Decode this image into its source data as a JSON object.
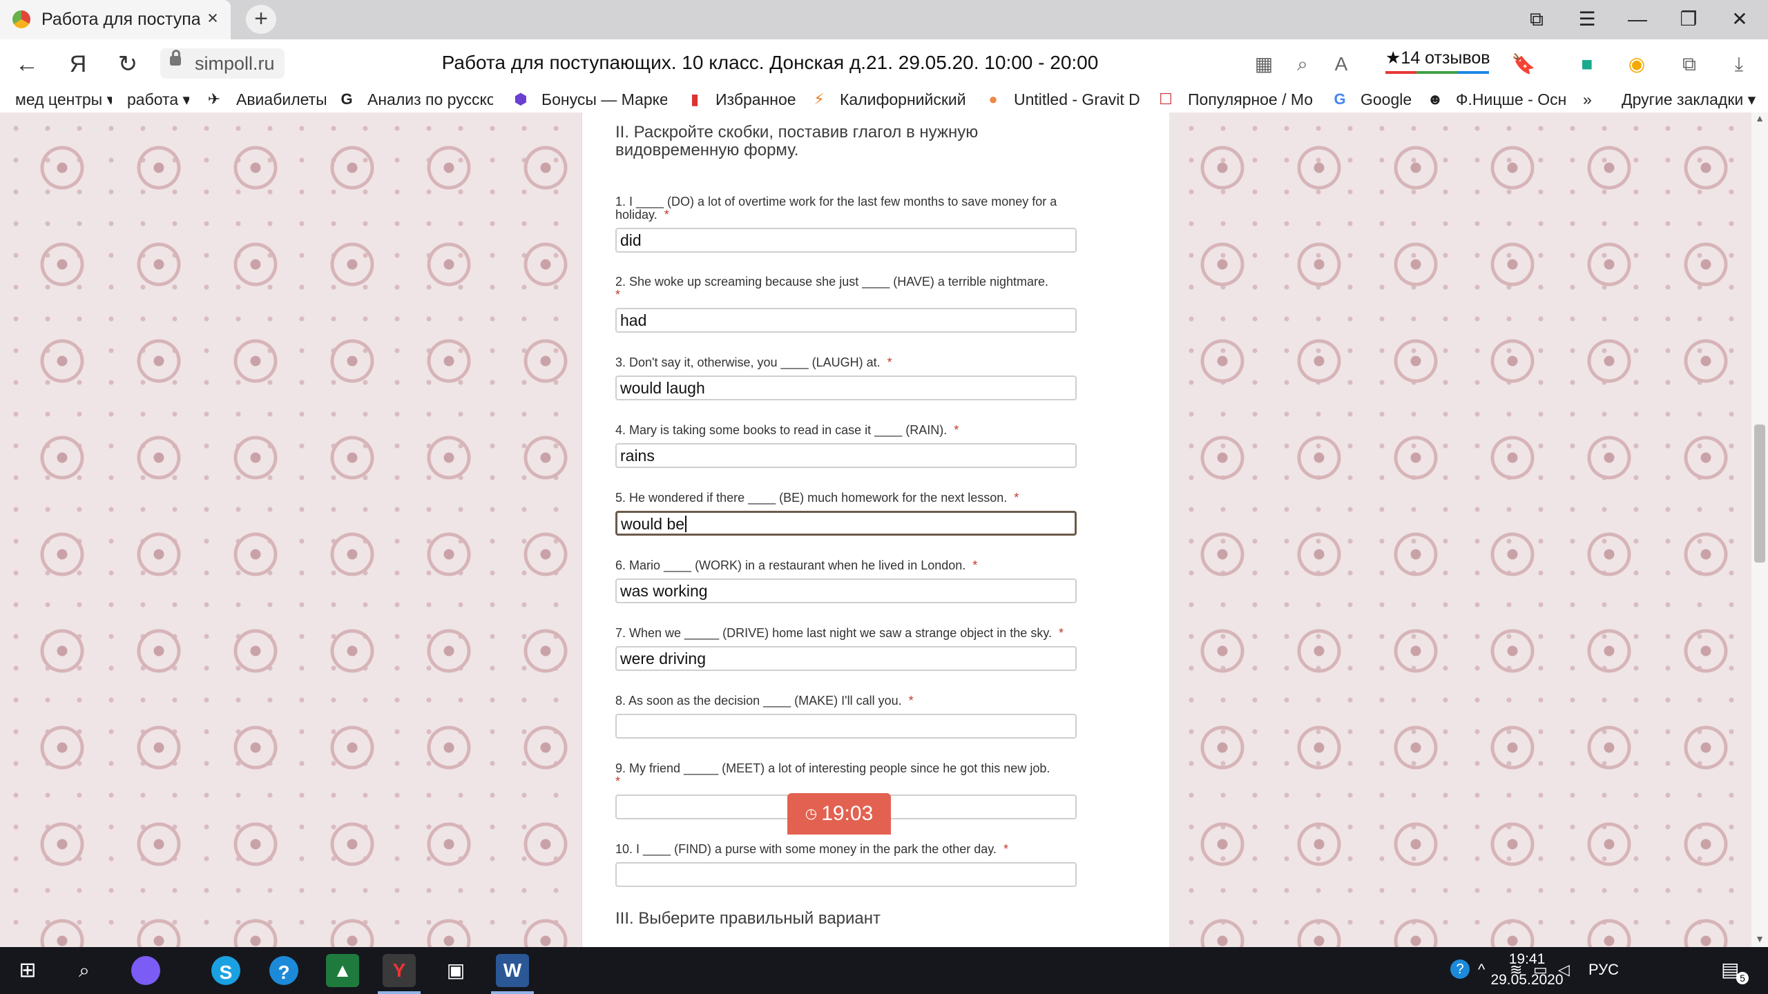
{
  "browser": {
    "tab_title": "Работа для поступающ",
    "tab_close": "×",
    "new_tab": "+",
    "url": "simpoll.ru",
    "page_title": "Работа для поступающих. 10 класс. Донская д.21. 29.05.20. 10:00 - 20:00",
    "reviews": "★14 отзывов",
    "window_controls": {
      "bookmarks": "⧉",
      "menu": "☰",
      "minimize": "—",
      "maximize": "❐",
      "close": "✕"
    },
    "nav": {
      "back": "←",
      "yandex": "Я",
      "reload": "↻"
    }
  },
  "bookmarks": [
    {
      "label": "мед центры ▾",
      "icon": ""
    },
    {
      "label": "работа ▾",
      "icon": ""
    },
    {
      "label": "Авиабилеты",
      "icon": "✈"
    },
    {
      "label": "Анализ по русском",
      "icon": "G"
    },
    {
      "label": "Бонусы — Маркет",
      "icon": "⬢"
    },
    {
      "label": "Избранное",
      "icon": "▮"
    },
    {
      "label": "Калифорнийский у",
      "icon": "⚡"
    },
    {
      "label": "Untitled - Gravit De",
      "icon": "●"
    },
    {
      "label": "Популярное / Мо",
      "icon": "☐"
    },
    {
      "label": "Google",
      "icon": "G"
    },
    {
      "label": "Ф.Ницше - Осн",
      "icon": "☻"
    }
  ],
  "bookmarks_more": "»",
  "bookmarks_other": "Другие закладки ▾",
  "form": {
    "section_title": "II. Раскройте скобки, поставив глагол в нужную видовременную форму.",
    "required_mark": "*",
    "questions": [
      {
        "label": "1. I ____ (DO) a lot of overtime work for the last few months to save money for a holiday.",
        "answer": "did"
      },
      {
        "label": "2. She woke up screaming because she just ____ (HAVE) a terrible nightmare.",
        "answer": "had"
      },
      {
        "label": "3. Don't say it, otherwise, you ____ (LAUGH) at.",
        "answer": "would laugh"
      },
      {
        "label": "4. Mary is taking some books to read in case it ____ (RAIN).",
        "answer": "rains"
      },
      {
        "label": "5. He wondered if there ____ (BE) much homework for the next lesson.",
        "answer": "would be"
      },
      {
        "label": "6. Mario ____ (WORK) in a restaurant when he lived in London.",
        "answer": "was working"
      },
      {
        "label": "7. When we _____ (DRIVE) home last night we saw a strange object in the sky.",
        "answer": "were driving"
      },
      {
        "label": "8. As soon as the decision ____ (MAKE) I'll call you.",
        "answer": ""
      },
      {
        "label": "9. My friend _____ (MEET) a lot of interesting people since he got this new job.",
        "answer": ""
      },
      {
        "label": "10. I ____ (FIND) a purse with some money in the park the other day.",
        "answer": ""
      }
    ],
    "next_section_title": "III. Выберите правильный вариант"
  },
  "timer": "19:03",
  "taskbar": {
    "lang": "РУС",
    "time": "19:41",
    "date": "29.05.2020",
    "notifications": "5"
  },
  "colors": {
    "accent_timer": "#e36150",
    "page_bg": "#f0e5e6",
    "taskbar": "#15171d"
  }
}
